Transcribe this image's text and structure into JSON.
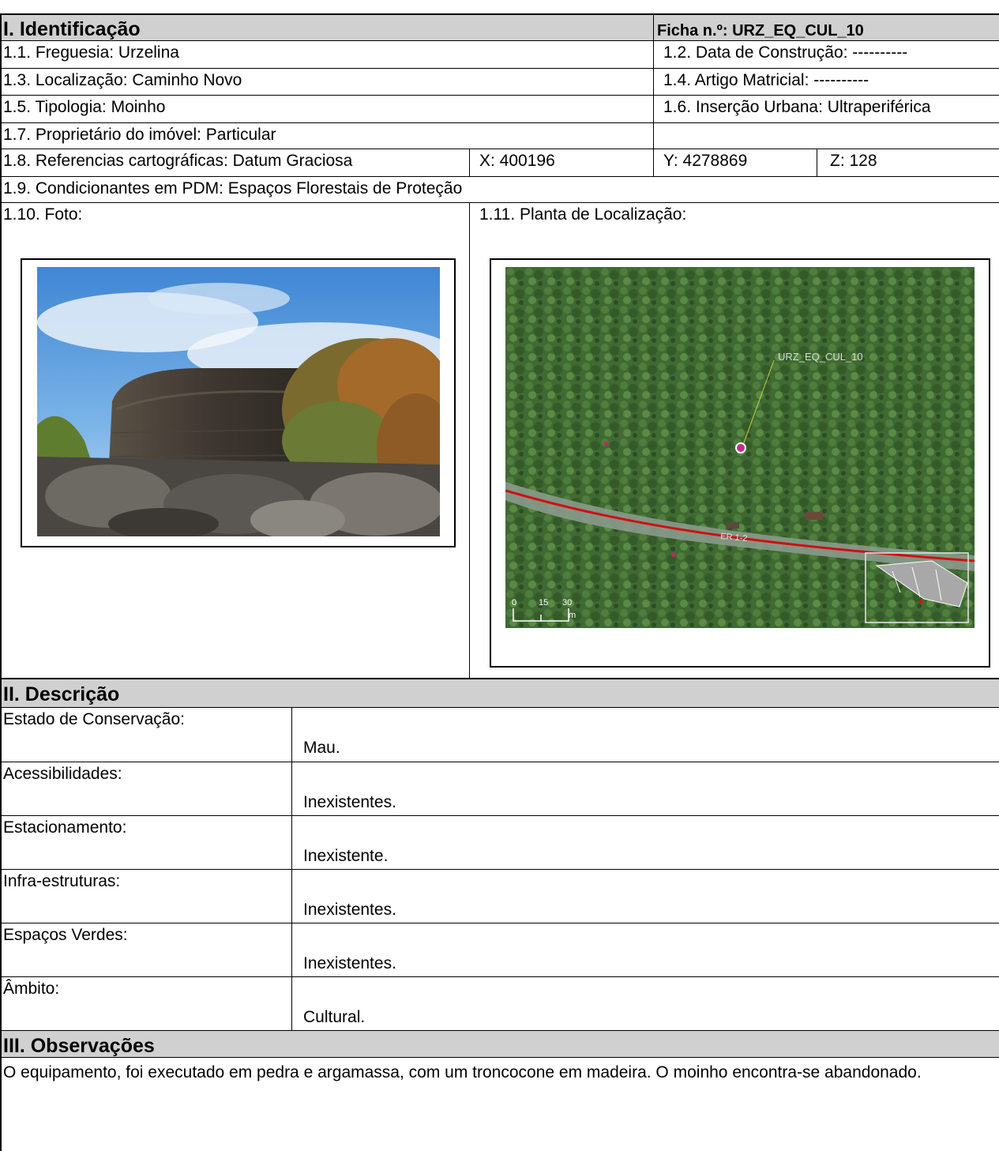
{
  "identificacao": {
    "title": "I. Identificação",
    "ficha": "Ficha n.º: URZ_EQ_CUL_10",
    "freguesia": "1.1. Freguesia: Urzelina",
    "data_construcao": "1.2. Data de Construção: ----------",
    "localizacao": "1.3. Localização: Caminho Novo",
    "artigo_matricial": "1.4. Artigo Matricial: ----------",
    "tipologia": "1.5. Tipologia: Moinho",
    "insercao_urbana": "1.6. Inserção Urbana: Ultraperiférica",
    "proprietario": "1.7. Proprietário do imóvel: Particular",
    "referencias": "1.8. Referencias cartográficas: Datum Graciosa",
    "x": "X: 400196",
    "y": "Y: 4278869",
    "z": "Z: 128",
    "condicionantes": "1.9. Condicionantes em PDM: Espaços Florestais de Proteção",
    "foto_label": "1.10. Foto:",
    "planta_label": "1.11. Planta de Localização:"
  },
  "map": {
    "feature_label": "URZ_EQ_CUL_10",
    "road_label": "ER 1-2",
    "scale_labels": [
      "0",
      "15",
      "30"
    ],
    "scale_unit": "m"
  },
  "descricao": {
    "title": "II. Descrição",
    "rows": [
      {
        "label": "Estado de Conservação:",
        "value": "Mau."
      },
      {
        "label": "Acessibilidades:",
        "value": "Inexistentes."
      },
      {
        "label": "Estacionamento:",
        "value": "Inexistente."
      },
      {
        "label": "Infra-estruturas:",
        "value": "Inexistentes."
      },
      {
        "label": "Espaços Verdes:",
        "value": "Inexistentes."
      },
      {
        "label": "Âmbito:",
        "value": "Cultural."
      }
    ]
  },
  "observacoes": {
    "title": "III. Observações",
    "text": "O equipamento, foi executado em pedra e argamassa, com um troncocone em madeira. O moinho encontra-se abandonado."
  }
}
